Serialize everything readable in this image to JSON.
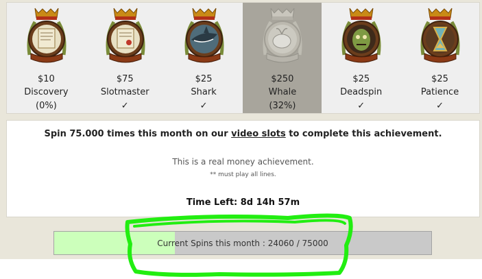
{
  "achievements": [
    {
      "price": "$10",
      "name": "Discovery",
      "status": "(0%)",
      "medal": "scroll-medal-icon",
      "active": false
    },
    {
      "price": "$75",
      "name": "Slotmaster",
      "status": "✓",
      "medal": "scroll-medal-icon",
      "active": false
    },
    {
      "price": "$25",
      "name": "Shark",
      "status": "✓",
      "medal": "shark-medal-icon",
      "active": false
    },
    {
      "price": "$250",
      "name": "Whale",
      "status": "(32%)",
      "medal": "whale-medal-icon",
      "active": true
    },
    {
      "price": "$25",
      "name": "Deadspin",
      "status": "✓",
      "medal": "zombie-medal-icon",
      "active": false
    },
    {
      "price": "$25",
      "name": "Patience",
      "status": "✓",
      "medal": "hourglass-medal-icon",
      "active": false
    }
  ],
  "details": {
    "instruction_before": "Spin 75.000 times this month on our ",
    "instruction_link": "video slots",
    "instruction_after": " to complete this achievement.",
    "real_money": "This is a real money achievement.",
    "note": "** must play all lines.",
    "time_left": "Time Left: 8d 14h 57m"
  },
  "progress": {
    "label": "Current Spins this month : 24060 / 75000",
    "current": 24060,
    "target": 75000
  },
  "colors": {
    "active_badge": "#a8a59c",
    "progress_fill": "#ccffbb",
    "progress_track": "#c9c9c9",
    "annotation": "#22ee11"
  }
}
